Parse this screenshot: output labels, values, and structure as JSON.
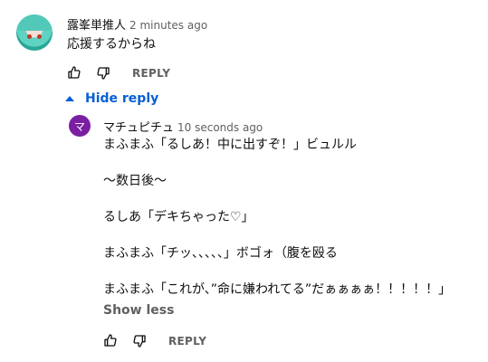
{
  "comment": {
    "author": "露峯単推人",
    "timestamp": "2 minutes ago",
    "text": "応援するからね",
    "reply_label": "REPLY",
    "avatar_icon": "anime-avatar-icon"
  },
  "toggle": {
    "hide_reply_label": "Hide reply",
    "icon": "caret-up-icon",
    "color": "#065fd4"
  },
  "reply": {
    "author": "マチュピチュ",
    "avatar_letter": "マ",
    "avatar_color": "#7b1fa2",
    "timestamp": "10 seconds ago",
    "lines": [
      "まふまふ「るしあ！中に出すぞ！」ビュルル",
      "～数日後～",
      "るしあ「デキちゃった♡」",
      "まふまふ「チッ、、、、、」ボゴォ（腹を殴る",
      "まふまふ「これが、”命に嫌われてる”だぁぁぁぁ！！！！！」"
    ],
    "show_less_label": "Show less",
    "reply_label": "REPLY"
  }
}
